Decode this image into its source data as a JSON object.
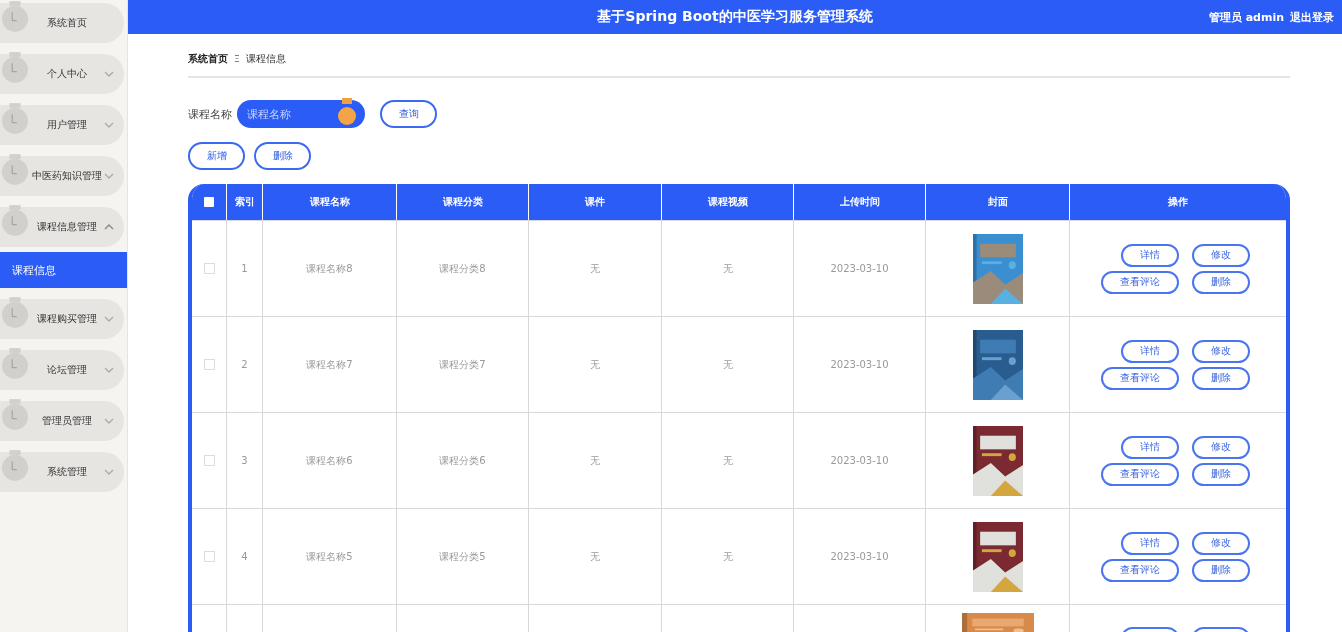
{
  "header": {
    "title": "基于Spring Boot的中医学习服务管理系统",
    "user": "管理员 admin",
    "logout": "退出登录"
  },
  "sidebar": {
    "items": [
      {
        "label": "系统首页"
      },
      {
        "label": "个人中心",
        "expanded": false
      },
      {
        "label": "用户管理",
        "expanded": false
      },
      {
        "label": "中医药知识管理",
        "expanded": false
      },
      {
        "label": "课程信息管理",
        "expanded": true,
        "children": [
          {
            "label": "课程信息",
            "selected": true
          }
        ]
      },
      {
        "label": "课程购买管理",
        "expanded": false
      },
      {
        "label": "论坛管理",
        "expanded": false
      },
      {
        "label": "管理员管理",
        "expanded": false
      },
      {
        "label": "系统管理",
        "expanded": false
      }
    ]
  },
  "breadcrumb": {
    "items": [
      "系统首页",
      "课程信息"
    ],
    "separator": "Ξ"
  },
  "search": {
    "label": "课程名称",
    "placeholder": "课程名称",
    "button": "查询"
  },
  "toolbar": {
    "buttons": [
      "新增",
      "删除"
    ]
  },
  "table": {
    "select_all": {
      "checked": false
    },
    "columns": [
      "索引",
      "课程名称",
      "课程分类",
      "课件",
      "课程视频",
      "上传时间",
      "封面",
      "操作"
    ],
    "rows": [
      {
        "selected": false,
        "index": "1",
        "name": "课程名称8",
        "category": "课程分类8",
        "courseware": "无",
        "video": "无",
        "time": "2023-03-10",
        "cover": {
          "kind": "picture"
        },
        "actions": [
          "详情",
          "修改",
          "查看评论",
          "删除"
        ]
      },
      {
        "selected": false,
        "index": "2",
        "name": "课程名称7",
        "category": "课程分类7",
        "courseware": "无",
        "video": "无",
        "time": "2023-03-10",
        "cover": {
          "kind": "picture"
        },
        "actions": [
          "详情",
          "修改",
          "查看评论",
          "删除"
        ]
      },
      {
        "selected": false,
        "index": "3",
        "name": "课程名称6",
        "category": "课程分类6",
        "courseware": "无",
        "video": "无",
        "time": "2023-03-10",
        "cover": {
          "kind": "picture"
        },
        "actions": [
          "详情",
          "修改",
          "查看评论",
          "删除"
        ]
      },
      {
        "selected": false,
        "index": "4",
        "name": "课程名称5",
        "category": "课程分类5",
        "courseware": "无",
        "video": "无",
        "time": "2023-03-10",
        "cover": {
          "kind": "picture"
        },
        "actions": [
          "详情",
          "修改",
          "查看评论",
          "删除"
        ]
      },
      {
        "partial": true,
        "cover": {
          "kind": "picture"
        }
      }
    ]
  }
}
